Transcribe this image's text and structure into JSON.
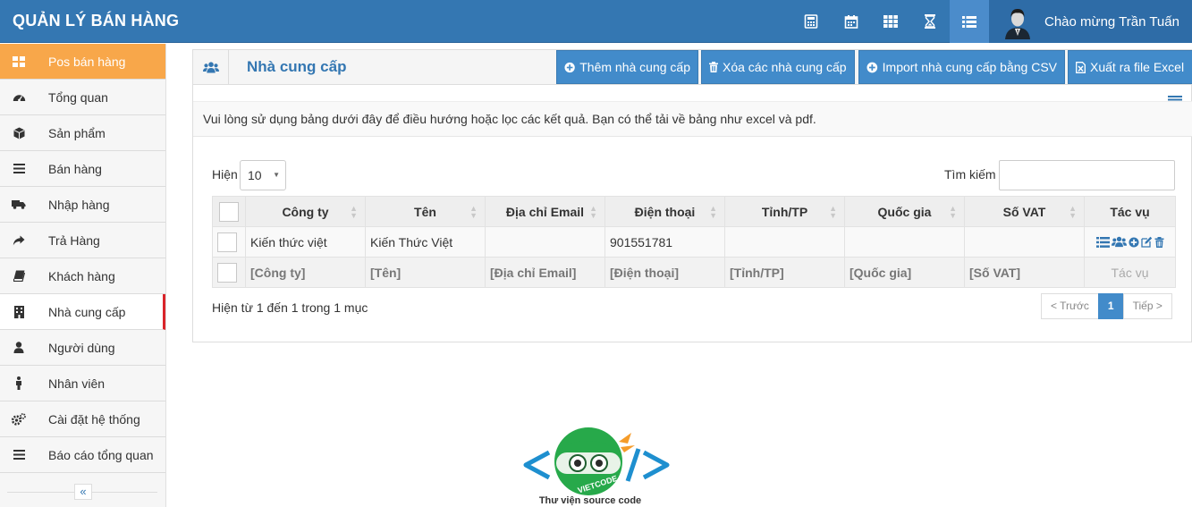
{
  "header": {
    "brand": "QUẢN LÝ BÁN HÀNG",
    "icons": [
      "calculator-icon",
      "calendar-icon",
      "grid-icon",
      "hourglass-icon",
      "list-icon"
    ],
    "greeting": "Chào mừng Trần Tuấn"
  },
  "sidebar": {
    "items": [
      {
        "label": "Pos bán hàng",
        "icon": "th-large-icon"
      },
      {
        "label": "Tổng quan",
        "icon": "dashboard-icon"
      },
      {
        "label": "Sản phẩm",
        "icon": "cube-icon"
      },
      {
        "label": "Bán hàng",
        "icon": "bars-icon"
      },
      {
        "label": "Nhập hàng",
        "icon": "truck-icon"
      },
      {
        "label": "Trả Hàng",
        "icon": "share-icon"
      },
      {
        "label": "Khách hàng",
        "icon": "book-icon"
      },
      {
        "label": "Nhà cung cấp",
        "icon": "building-icon"
      },
      {
        "label": "Người dùng",
        "icon": "user-icon"
      },
      {
        "label": "Nhân viên",
        "icon": "male-icon"
      },
      {
        "label": "Cài đặt hệ thống",
        "icon": "cogs-icon"
      },
      {
        "label": "Báo cáo tổng quan",
        "icon": "bars-icon"
      }
    ],
    "collapse": "«"
  },
  "panel": {
    "title": "Nhà cung cấp",
    "buttons": {
      "add": "Thêm nhà cung cấp",
      "delete": "Xóa các nhà cung cấp",
      "import": "Import nhà cung cấp bằng CSV",
      "export": "Xuất ra file Excel"
    },
    "helper": "Vui lòng sử dụng bảng dưới đây để điều hướng hoặc lọc các kết quả. Bạn có thể tải về bảng như excel và pdf."
  },
  "table": {
    "show_label": "Hiện",
    "page_size": "10",
    "search_label": "Tìm kiếm",
    "search_value": "",
    "columns": [
      "Công ty",
      "Tên",
      "Địa chỉ Email",
      "Điện thoại",
      "Tỉnh/TP",
      "Quốc gia",
      "Số VAT",
      "Tác vụ"
    ],
    "rows": [
      {
        "company": "Kiến thức việt",
        "name": "Kiến Thức Việt",
        "email": "",
        "phone": "901551781",
        "city": "",
        "country": "",
        "vat": ""
      }
    ],
    "filters": [
      "[Công ty]",
      "[Tên]",
      "[Địa chỉ Email]",
      "[Điện thoại]",
      "[Tỉnh/TP]",
      "[Quốc gia]",
      "[Số VAT]",
      "Tác vụ"
    ],
    "info": "Hiện từ 1 đến 1 trong 1 mục",
    "pager": {
      "prev": "< Trước",
      "current": "1",
      "next": "Tiếp >"
    }
  },
  "footer_logo": {
    "text": "VIETCODE",
    "caption": "Thư viện source code"
  },
  "colors": {
    "header": "#3477b2",
    "primary_button": "#428bca",
    "active_sidebar": "#f8a74a",
    "current_marker": "#d9242a"
  }
}
